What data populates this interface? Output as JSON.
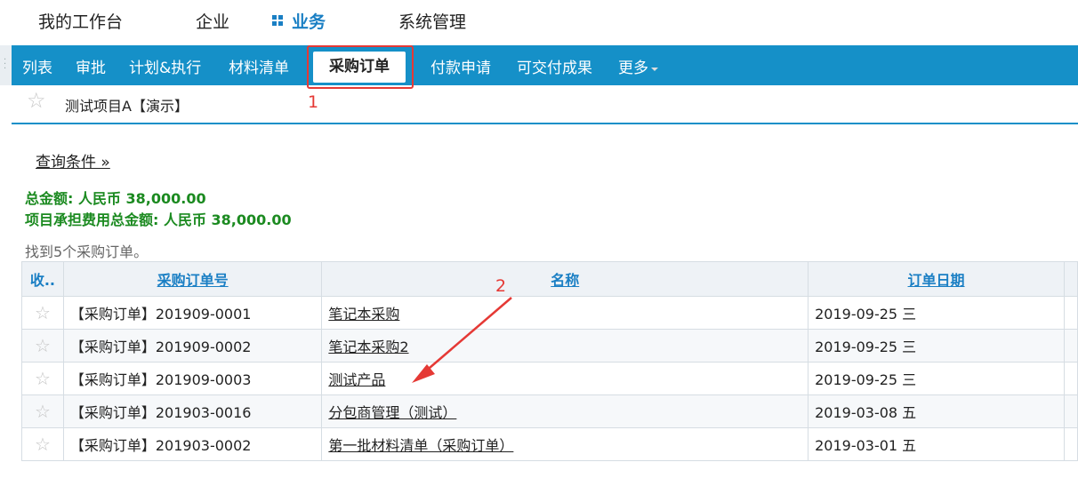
{
  "topnav": {
    "items": [
      {
        "label": "我的工作台"
      },
      {
        "label": "企业"
      },
      {
        "label": "业务",
        "active": true
      },
      {
        "label": "系统管理"
      }
    ]
  },
  "tabs": [
    {
      "label": "列表"
    },
    {
      "label": "审批"
    },
    {
      "label": "计划&执行"
    },
    {
      "label": "材料清单"
    },
    {
      "label": "采购订单",
      "active": true
    },
    {
      "label": "付款申请"
    },
    {
      "label": "可交付成果"
    },
    {
      "label": "更多"
    }
  ],
  "project": {
    "name": "测试项目A【演示】"
  },
  "query_link": "查询条件 »",
  "summary": {
    "total": "总金额: 人民币 38,000.00",
    "project_cost": "项目承担费用总金额: 人民币 38,000.00"
  },
  "found_text": "找到5个采购订单。",
  "table": {
    "headers": [
      "收..",
      "采购订单号",
      "名称",
      "订单日期"
    ],
    "rows": [
      {
        "order_no": "【采购订单】201909-0001",
        "name": "笔记本采购",
        "date": "2019-09-25 三"
      },
      {
        "order_no": "【采购订单】201909-0002",
        "name": "笔记本采购2",
        "date": "2019-09-25 三"
      },
      {
        "order_no": "【采购订单】201909-0003",
        "name": "测试产品",
        "date": "2019-09-25 三"
      },
      {
        "order_no": "【采购订单】201903-0016",
        "name": "分包商管理（测试）",
        "date": "2019-03-08 五"
      },
      {
        "order_no": "【采购订单】201903-0002",
        "name": "第一批材料清单（采购订单）",
        "date": "2019-03-01 五"
      }
    ]
  },
  "annotations": {
    "mark1": "1",
    "mark2": "2",
    "color": "#e53935"
  },
  "colors": {
    "tabbar": "#1590c8",
    "link": "#1a7fc4",
    "summary": "#1b8a20"
  }
}
